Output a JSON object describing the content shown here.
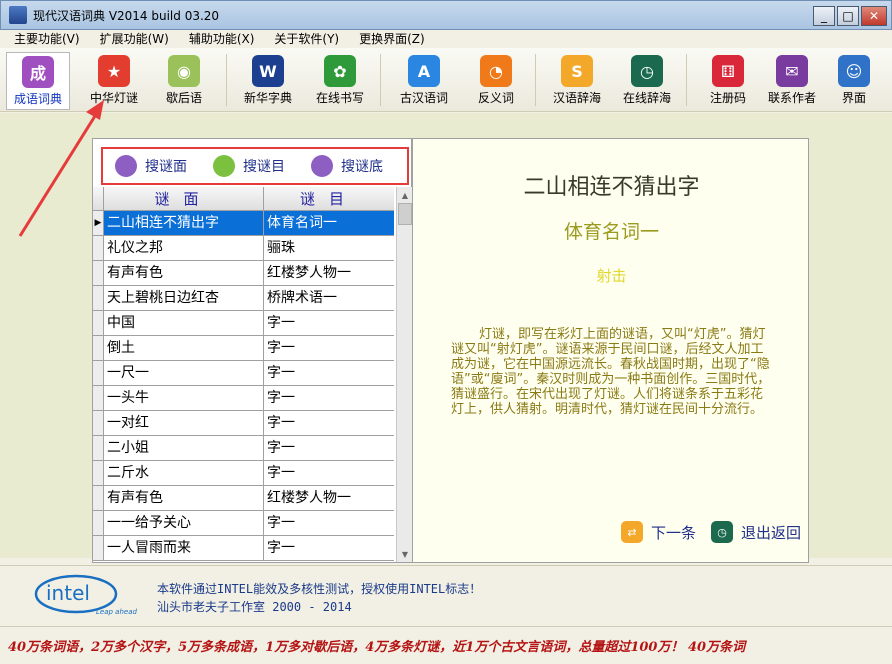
{
  "window": {
    "title": "现代汉语词典 V2014 build 03.20",
    "minimize": "_",
    "maximize": "□",
    "close": "✕"
  },
  "menu": [
    "主要功能(V)",
    "扩展功能(W)",
    "辅助功能(X)",
    "关于软件(Y)",
    "更换界面(Z)"
  ],
  "toolbar": [
    {
      "label": "成语词典",
      "icon": "idiom-icon",
      "color": "#a04fc0",
      "glyph": "成"
    },
    {
      "label": "中华灯谜",
      "icon": "star-icon",
      "color": "#e23d2f",
      "glyph": "★"
    },
    {
      "label": "歇后语",
      "icon": "landscape-icon",
      "color": "#9bc25a",
      "glyph": "◉"
    },
    {
      "label": "新华字典",
      "icon": "book-icon",
      "color": "#1c3f8f",
      "glyph": "W"
    },
    {
      "label": "在线书写",
      "icon": "gear-icon",
      "color": "#2f9a3a",
      "glyph": "✿"
    },
    {
      "label": "古汉语词",
      "icon": "app-store-icon",
      "color": "#2a86e0",
      "glyph": "A"
    },
    {
      "label": "反义词",
      "icon": "rss-icon",
      "color": "#f07a1a",
      "glyph": "◔"
    },
    {
      "label": "汉语辞海",
      "icon": "s-icon",
      "color": "#f3a82a",
      "glyph": "S"
    },
    {
      "label": "在线辞海",
      "icon": "clock-icon",
      "color": "#1b6a50",
      "glyph": "◷"
    },
    {
      "label": "注册码",
      "icon": "dice-icon",
      "color": "#d8283a",
      "glyph": "⚅"
    },
    {
      "label": "联系作者",
      "icon": "mail-icon",
      "color": "#7a3b9e",
      "glyph": "✉"
    },
    {
      "label": "界面",
      "icon": "finder-icon",
      "color": "#2f72c8",
      "glyph": "☺"
    }
  ],
  "search": [
    {
      "label": "搜谜面",
      "icon": "chat-bubble-icon"
    },
    {
      "label": "搜谜目",
      "icon": "chat-bubble-icon"
    },
    {
      "label": "搜谜底",
      "icon": "chat-bubble-icon"
    }
  ],
  "grid": {
    "col1": "谜面",
    "col2": "谜目",
    "rows": [
      [
        "二山相连不猜出字",
        "体育名词一"
      ],
      [
        "礼仪之邦",
        "骊珠"
      ],
      [
        "有声有色",
        "红楼梦人物一"
      ],
      [
        "天上碧桃日边红杏",
        "桥牌术语一"
      ],
      [
        "中国",
        "字一"
      ],
      [
        "倒土",
        "字一"
      ],
      [
        "一尺一",
        "字一"
      ],
      [
        "一头牛",
        "字一"
      ],
      [
        "一对红",
        "字一"
      ],
      [
        "二小姐",
        "字一"
      ],
      [
        "二斤水",
        "字一"
      ],
      [
        "有声有色",
        "红楼梦人物一"
      ],
      [
        "一一给予关心",
        "字一"
      ],
      [
        "一人冒雨而来",
        "字一"
      ]
    ]
  },
  "detail": {
    "title": "二山相连不猜出字",
    "category": "体育名词一",
    "answer": "射击",
    "description": "灯谜，即写在彩灯上面的谜语，又叫“灯虎”。猜灯谜又叫“射灯虎”。谜语来源于民间口谜，后经文人加工成为谜，它在中国源远流长。春秋战国时期，出现了“隐语”或“廋词”。秦汉时则成为一种书面创作。三国时代，猜谜盛行。在宋代出现了灯谜。人们将谜条系于五彩花灯上，供人猜射。明清时代，猜灯谜在民间十分流行。",
    "next_label": "下一条",
    "back_label": "退出返回"
  },
  "footer": {
    "logo_text": "intel",
    "logo_tagline": "Leap ahead",
    "line1": "本软件通过INTEL能效及多核性测试，授权使用INTEL标志！",
    "line2": "汕头市老夫子工作室 2000 - 2014"
  },
  "ticker": "40万条词语，2万多个汉字，5万多条成语，1万多对歇后语，4万多条灯谜，近1万个古文言语词，总量超过100万！   40万条词"
}
